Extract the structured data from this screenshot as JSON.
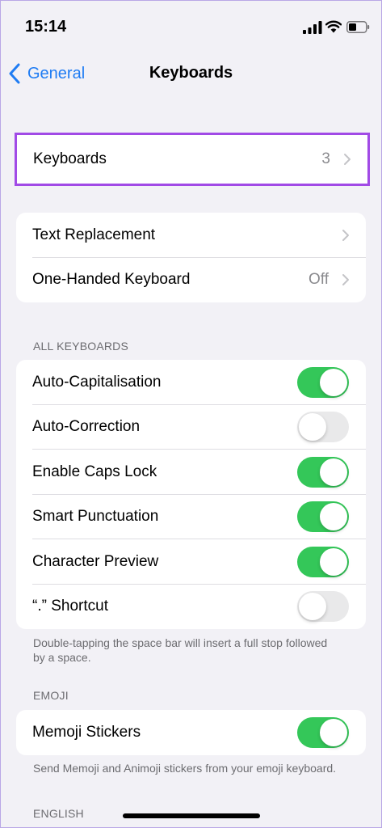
{
  "status_bar": {
    "time": "15:14"
  },
  "nav": {
    "back_label": "General",
    "title": "Keyboards"
  },
  "keyboards_row": {
    "label": "Keyboards",
    "value": "3"
  },
  "group2": [
    {
      "label": "Text Replacement",
      "value": ""
    },
    {
      "label": "One-Handed Keyboard",
      "value": "Off"
    }
  ],
  "all_keyboards": {
    "header": "ALL KEYBOARDS",
    "items": [
      {
        "label": "Auto-Capitalisation",
        "on": true
      },
      {
        "label": "Auto-Correction",
        "on": false
      },
      {
        "label": "Enable Caps Lock",
        "on": true
      },
      {
        "label": "Smart Punctuation",
        "on": true
      },
      {
        "label": "Character Preview",
        "on": true
      },
      {
        "label": "“.” Shortcut",
        "on": false
      }
    ],
    "footer": "Double-tapping the space bar will insert a full stop followed by a space."
  },
  "emoji": {
    "header": "EMOJI",
    "items": [
      {
        "label": "Memoji Stickers",
        "on": true
      }
    ],
    "footer": "Send Memoji and Animoji stickers from your emoji keyboard."
  },
  "english": {
    "header": "ENGLISH"
  },
  "colors": {
    "accent": "#1f7cf3",
    "toggle_on": "#34c759",
    "highlight": "#a14ae6"
  }
}
